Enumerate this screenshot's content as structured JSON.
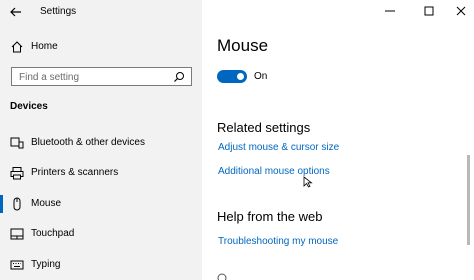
{
  "window": {
    "title": "Settings"
  },
  "sidebar": {
    "home_label": "Home",
    "search_placeholder": "Find a setting",
    "section_label": "Devices",
    "items": [
      {
        "label": "Bluetooth & other devices",
        "icon": "bluetooth-devices-icon"
      },
      {
        "label": "Printers & scanners",
        "icon": "printer-icon"
      },
      {
        "label": "Mouse",
        "icon": "mouse-icon",
        "selected": true
      },
      {
        "label": "Touchpad",
        "icon": "touchpad-icon"
      },
      {
        "label": "Typing",
        "icon": "keyboard-icon"
      }
    ]
  },
  "main": {
    "title": "Mouse",
    "toggle": {
      "state": "On",
      "on": true
    },
    "related_heading": "Related settings",
    "related_links": [
      "Adjust mouse & cursor size",
      "Additional mouse options"
    ],
    "help_heading": "Help from the web",
    "help_links": [
      "Troubleshooting my mouse"
    ]
  },
  "colors": {
    "accent": "#0067c0",
    "sidebar_bg": "#f2f2f2"
  }
}
